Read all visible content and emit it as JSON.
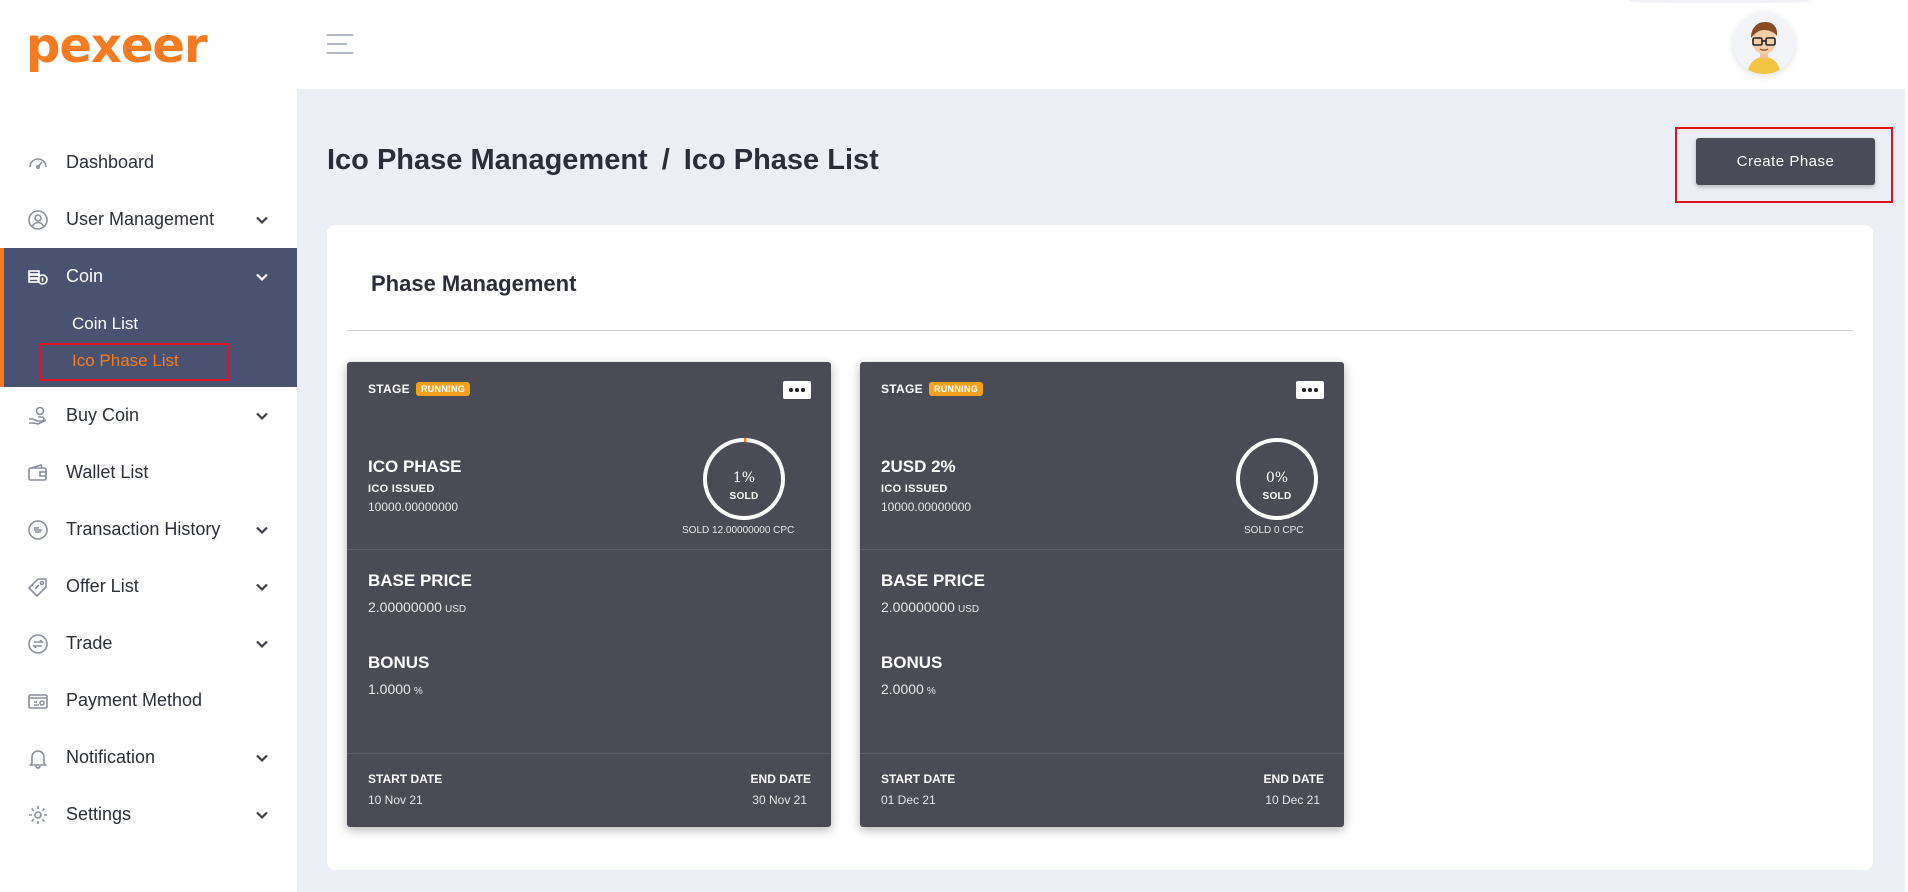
{
  "brand": {
    "logo_text": "pexeer",
    "accent": "#f47b20"
  },
  "sidebar": {
    "items": [
      {
        "label": "Dashboard",
        "icon": "speedometer-icon"
      },
      {
        "label": "User Management",
        "icon": "user-circle-icon"
      },
      {
        "label": "Coin",
        "icon": "coins-icon"
      },
      {
        "label": "Buy Coin",
        "icon": "hand-coin-icon"
      },
      {
        "label": "Wallet List",
        "icon": "wallet-icon"
      },
      {
        "label": "Transaction History",
        "icon": "pay-badge-icon"
      },
      {
        "label": "Offer List",
        "icon": "tag-icon"
      },
      {
        "label": "Trade",
        "icon": "exchange-icon"
      },
      {
        "label": "Payment Method",
        "icon": "payment-icon"
      },
      {
        "label": "Notification",
        "icon": "bell-icon"
      },
      {
        "label": "Settings",
        "icon": "gear-icon"
      }
    ],
    "coin_sub": [
      "Coin List",
      "Ico Phase List"
    ]
  },
  "header": {
    "breadcrumb_parent": "Ico Phase Management",
    "breadcrumb_sep": "/",
    "breadcrumb_current": "Ico Phase List",
    "create_button": "Create Phase"
  },
  "panel": {
    "title": "Phase Management"
  },
  "cards": [
    {
      "stage_label": "STAGE",
      "status": "RUNNING",
      "name": "ICO PHASE",
      "issued_label": "ICO ISSUED",
      "issued_value": "10000.00000000",
      "sold_percent": "1%",
      "sold_word": "SOLD",
      "sold_line": "SOLD 12.00000000 CPC",
      "base_price_label": "BASE PRICE",
      "base_price_value": "2.00000000",
      "base_price_unit": "USD",
      "bonus_label": "BONUS",
      "bonus_value": "1.0000",
      "bonus_unit": "%",
      "start_label": "START DATE",
      "start_value": "10 Nov 21",
      "end_label": "END DATE",
      "end_value": "30 Nov 21"
    },
    {
      "stage_label": "STAGE",
      "status": "RUNNING",
      "name": "2USD 2%",
      "issued_label": "ICO ISSUED",
      "issued_value": "10000.00000000",
      "sold_percent": "0%",
      "sold_word": "SOLD",
      "sold_line": "SOLD 0 CPC",
      "base_price_label": "BASE PRICE",
      "base_price_value": "2.00000000",
      "base_price_unit": "USD",
      "bonus_label": "BONUS",
      "bonus_value": "2.0000",
      "bonus_unit": "%",
      "start_label": "START DATE",
      "start_value": "01 Dec 21",
      "end_label": "END DATE",
      "end_value": "10 Dec 21"
    }
  ]
}
